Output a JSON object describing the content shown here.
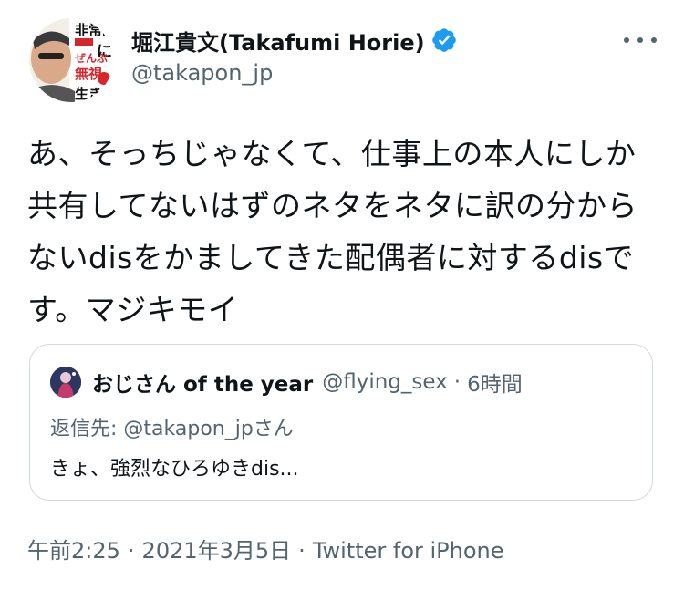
{
  "tweet": {
    "author": {
      "display_name": "堀江貴文(Takafumi Horie)",
      "handle": "@takapon_jp",
      "verified_icon": "verified-badge-icon",
      "avatar_icon": "profile-avatar",
      "avatar_text": [
        "非常識",
        "に",
        "ぜんぶ",
        "無視",
        "生き"
      ]
    },
    "more_icon": "more-options-icon",
    "text": "あ、そっちじゃなくて、仕事上の本人にしか共有してないはずのネタをネタに訳の分からないdisをかましてきた配偶者に対するdisです。マジキモイ",
    "quote": {
      "display_name": "おじさん of the year",
      "handle": "@flying_sex",
      "separator": "·",
      "time": "6時間",
      "reply_to": "返信先: @takapon_jpさん",
      "text": "きょ、強烈なひろゆきdis..."
    },
    "meta": {
      "time": "午前2:25",
      "separator": "·",
      "date": "2021年3月5日",
      "source": "Twitter for iPhone"
    }
  },
  "colors": {
    "text_primary": "#0f1419",
    "text_secondary": "#536471",
    "verified_blue": "#1d9bf0",
    "border": "#cfd9de"
  }
}
